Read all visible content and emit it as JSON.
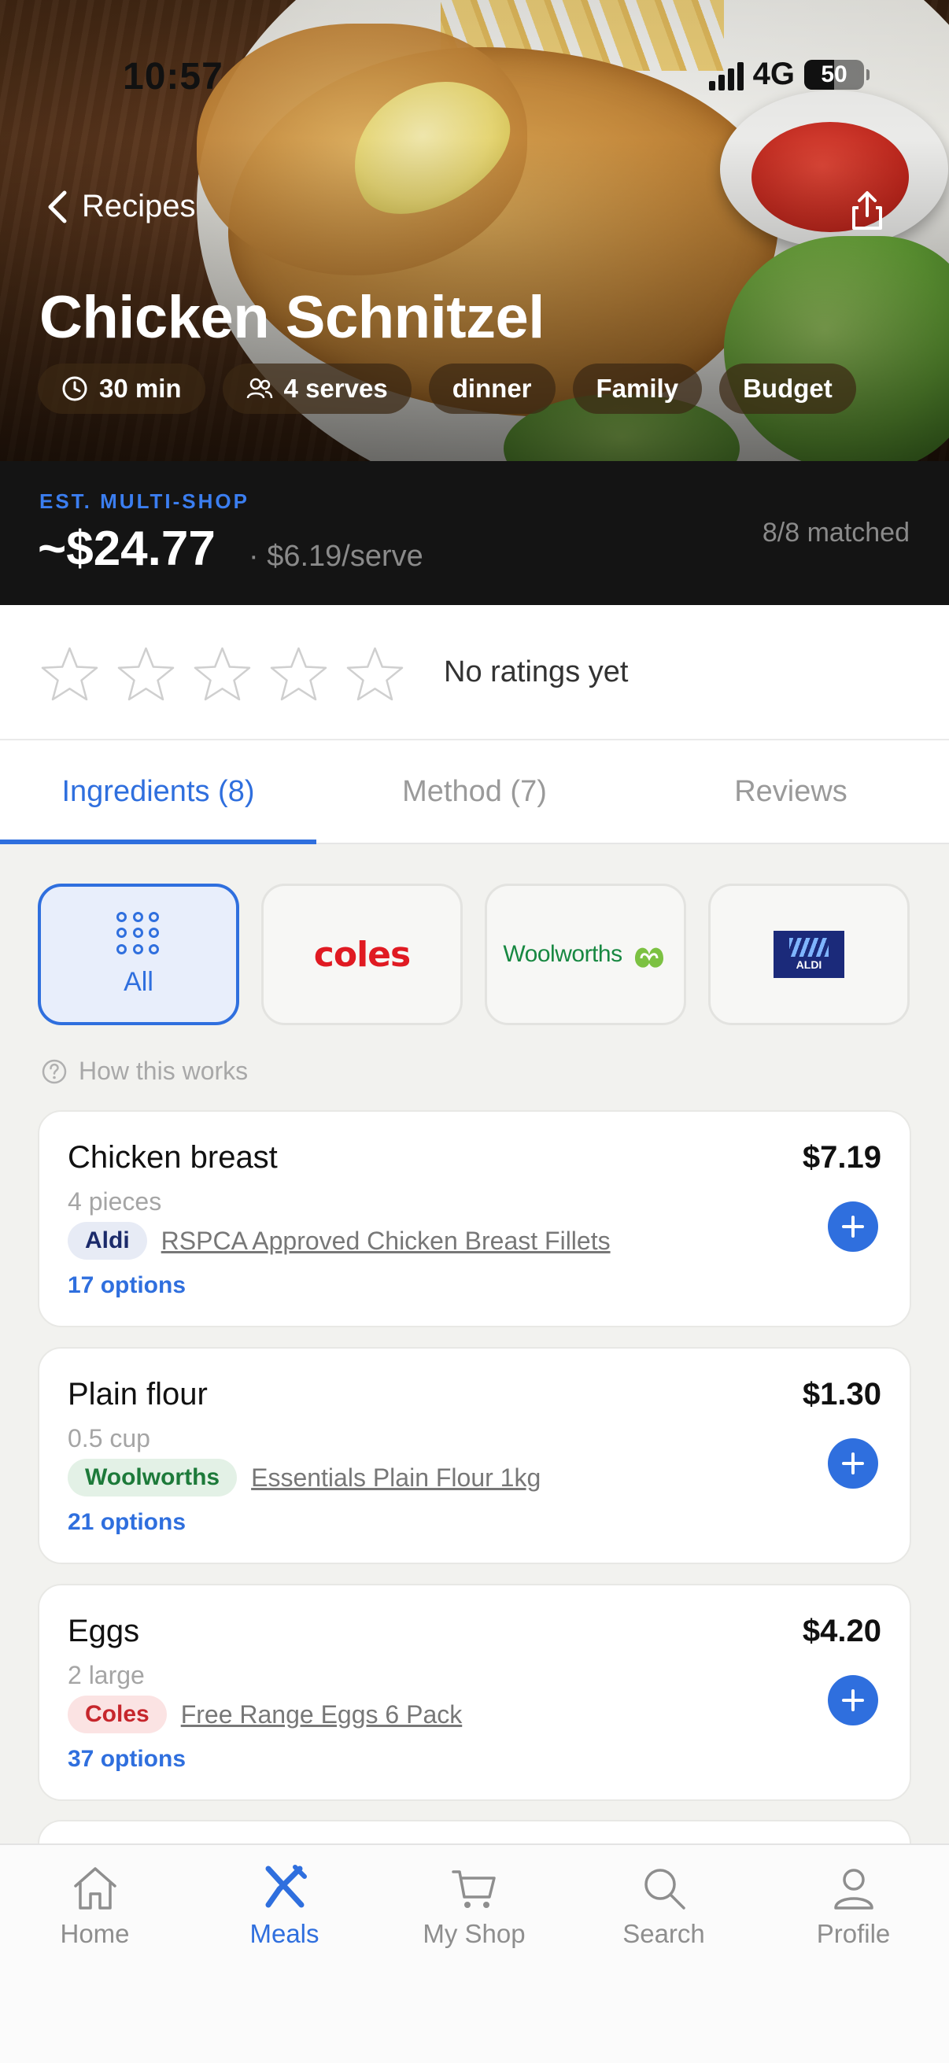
{
  "status": {
    "time": "10:57",
    "network": "4G",
    "battery": "50",
    "battery_level": 0.5
  },
  "header": {
    "back_label": "Recipes",
    "title": "Chicken Schnitzel"
  },
  "chips": [
    {
      "icon": "clock-icon",
      "label": "30 min"
    },
    {
      "icon": "people-icon",
      "label": "4 serves"
    },
    {
      "label": "dinner"
    },
    {
      "label": "Family"
    },
    {
      "label": "Budget"
    }
  ],
  "price": {
    "label": "EST. MULTI-SHOP",
    "total": "~$24.77",
    "per_serve": "· $6.19/serve",
    "matched": "8/8 matched"
  },
  "rating": {
    "stars": 0,
    "max": 5,
    "text": "No ratings yet"
  },
  "tabs": [
    {
      "label": "Ingredients (8)",
      "active": true
    },
    {
      "label": "Method (7)"
    },
    {
      "label": "Reviews"
    }
  ],
  "stores": [
    {
      "label": "All",
      "active": true
    },
    {
      "label": "coles"
    },
    {
      "label": "Woolworths"
    },
    {
      "label": "ALDI"
    }
  ],
  "how_label": "How this works",
  "ingredients": [
    {
      "name": "Chicken breast",
      "qty": "4 pieces",
      "store": "Aldi",
      "product": "RSPCA Approved Chicken Breast Fillets",
      "options": "17 options",
      "price": "$7.19"
    },
    {
      "name": "Plain flour",
      "qty": "0.5 cup",
      "store": "Woolworths",
      "product": "Essentials Plain Flour 1kg",
      "options": "21 options",
      "price": "$1.30"
    },
    {
      "name": "Eggs",
      "qty": "2 large",
      "store": "Coles",
      "product": "Free Range Eggs 6 Pack",
      "options": "37 options",
      "price": "$4.20"
    }
  ],
  "nav": [
    {
      "icon": "home-icon",
      "label": "Home"
    },
    {
      "icon": "meals-icon",
      "label": "Meals",
      "active": true
    },
    {
      "icon": "cart-icon",
      "label": "My Shop"
    },
    {
      "icon": "search-icon",
      "label": "Search"
    },
    {
      "icon": "profile-icon",
      "label": "Profile"
    }
  ],
  "colors": {
    "accent": "#2f6fde",
    "price_band": "#141414",
    "content_bg": "#f2f2ef"
  }
}
